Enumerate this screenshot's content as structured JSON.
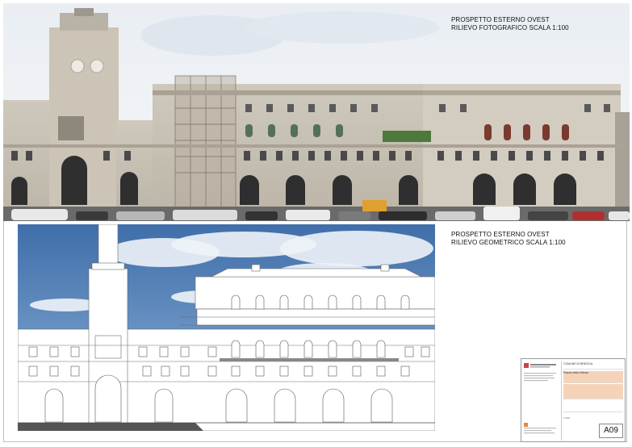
{
  "captions": {
    "photo_line1": "PROSPETTO ESTERNO OVEST",
    "photo_line2": "RILIEVO FOTOGRAFICO SCALA 1:100",
    "drawing_line1": "PROSPETTO ESTERNO OVEST",
    "drawing_line2": "RILIEVO GEOMETRICO SCALA 1:100"
  },
  "title_block": {
    "client": "COMUNE DI BRESCIA",
    "project_line": "Piazza della Vittoria",
    "sheet_code": "A09",
    "scale_text": "1:100"
  },
  "colors": {
    "sky_top": "#4f7fb8",
    "sky_bottom": "#9dc0e2",
    "stone": "#d9d2c6",
    "facade_line": "#6b6b6b",
    "accent_orange": "#f5d3b8"
  }
}
